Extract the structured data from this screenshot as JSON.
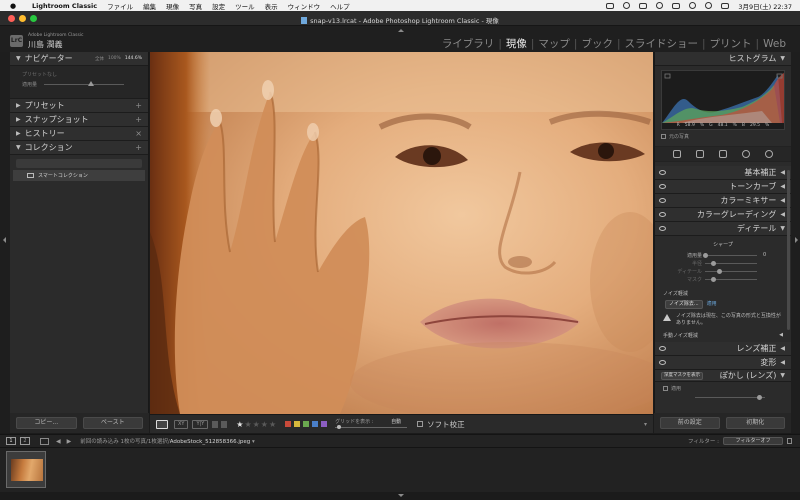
{
  "menubar": {
    "app_name": "Lightroom Classic",
    "items": [
      "ファイル",
      "編集",
      "現像",
      "写真",
      "設定",
      "ツール",
      "表示",
      "ウィンドウ",
      "ヘルプ"
    ],
    "clock": "3月9日(土)  22:37"
  },
  "window": {
    "title": "snap-v13.lrcat - Adobe Photoshop Lightroom Classic - 現像"
  },
  "identity": {
    "badge": "LrC",
    "product_small": "Adobe Lightroom Classic",
    "user_name": "川島 潤義"
  },
  "modules": {
    "items": [
      "ライブラリ",
      "現像",
      "マップ",
      "ブック",
      "スライドショー",
      "プリント",
      "Web"
    ],
    "active": "現像"
  },
  "left_panel": {
    "navigator": {
      "label": "ナビゲーター",
      "zoom_options": [
        "全体",
        "100%",
        "144.6%"
      ],
      "preset_label": "プリセットなし",
      "amount_label": "適用量"
    },
    "presets_label": "プリセット",
    "snapshots_label": "スナップショット",
    "history_label": "ヒストリー",
    "collections": {
      "label": "コレクション",
      "smart_collection": "スマートコレクション"
    },
    "copy_button": "コピー...",
    "paste_button": "ペースト"
  },
  "toolbar": {
    "view_grid": "XY",
    "view_survey": "Y|Y",
    "stars_on": "★",
    "stars_off": "★★★★",
    "label_colors": [
      "#c94a3a",
      "#d7b83c",
      "#6aa84f",
      "#4a7fc9",
      "#8c5ec2"
    ],
    "grid_label": "グリッドを表示 :",
    "grid_value": "自動",
    "soft_proof": "ソフト校正"
  },
  "right_panel": {
    "histogram": {
      "label": "ヒストグラム",
      "values": [
        "R",
        "58.9",
        "%",
        "G",
        "48.1",
        "%",
        "B",
        "29.5",
        "%"
      ],
      "original_photo": "元の写真"
    },
    "sections": {
      "basic": "基本補正",
      "tone_curve": "トーンカーブ",
      "color_mixer": "カラーミキサー",
      "color_grading": "カラーグレーディング",
      "detail": "ディテール",
      "lens": "レンズ補正",
      "transform": "変形",
      "vignette": "ぽかし (レンズ)"
    },
    "detail": {
      "sharpen_head": "シャープ",
      "sliders": [
        {
          "name": "適用量",
          "value": "0",
          "level": 0
        },
        {
          "name": "半径",
          "value": "",
          "level": 0.15
        },
        {
          "name": "ディテール",
          "value": "",
          "level": 0.25
        },
        {
          "name": "マスク",
          "value": "",
          "level": 0.15
        }
      ],
      "noise_head": "ノイズ軽減",
      "noise_button": "ノイズ除去...",
      "noise_status": "適用",
      "warning_text": "ノイズ除去は現在、この写真の形式と互換性がありません。",
      "manual_noise": "手動ノイズ軽減"
    },
    "vignette": {
      "mask_button": "深度マスクを表示",
      "apply_label": "適用"
    },
    "prev_button": "前の設定",
    "reset_button": "初期化"
  },
  "filmstrip": {
    "monitor1": "1",
    "monitor2": "2",
    "source_prefix": "前回の読み込み  1枚の写真/1枚選択/",
    "file_name": "AdobeStock_512858366.jpeg",
    "filter_label": "フィルター :",
    "filter_value": "フィルターオフ"
  }
}
